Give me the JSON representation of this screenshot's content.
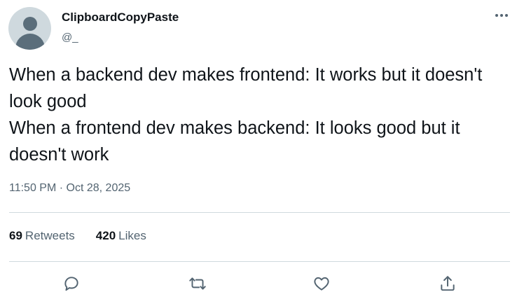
{
  "author": {
    "display_name": "ClipboardCopyPaste",
    "handle": "@_"
  },
  "tweet": {
    "text_lines": [
      "When a backend dev makes frontend: It works but it doesn't look good",
      "When a frontend dev makes backend: It looks good but it doesn't work"
    ],
    "timestamp": "11:50 PM · Oct 28, 2025"
  },
  "stats": {
    "retweets_count": "69",
    "retweets_label": "Retweets",
    "likes_count": "420",
    "likes_label": "Likes"
  },
  "actions": [
    "reply-icon",
    "retweet-icon",
    "like-icon",
    "share-icon"
  ],
  "menu": {
    "icon": "more-icon"
  },
  "colors": {
    "text_primary": "#0f1419",
    "text_secondary": "#536471",
    "divider": "#cfd9de",
    "avatar_bg": "#cfd9de",
    "avatar_fg": "#5b6e7b"
  }
}
